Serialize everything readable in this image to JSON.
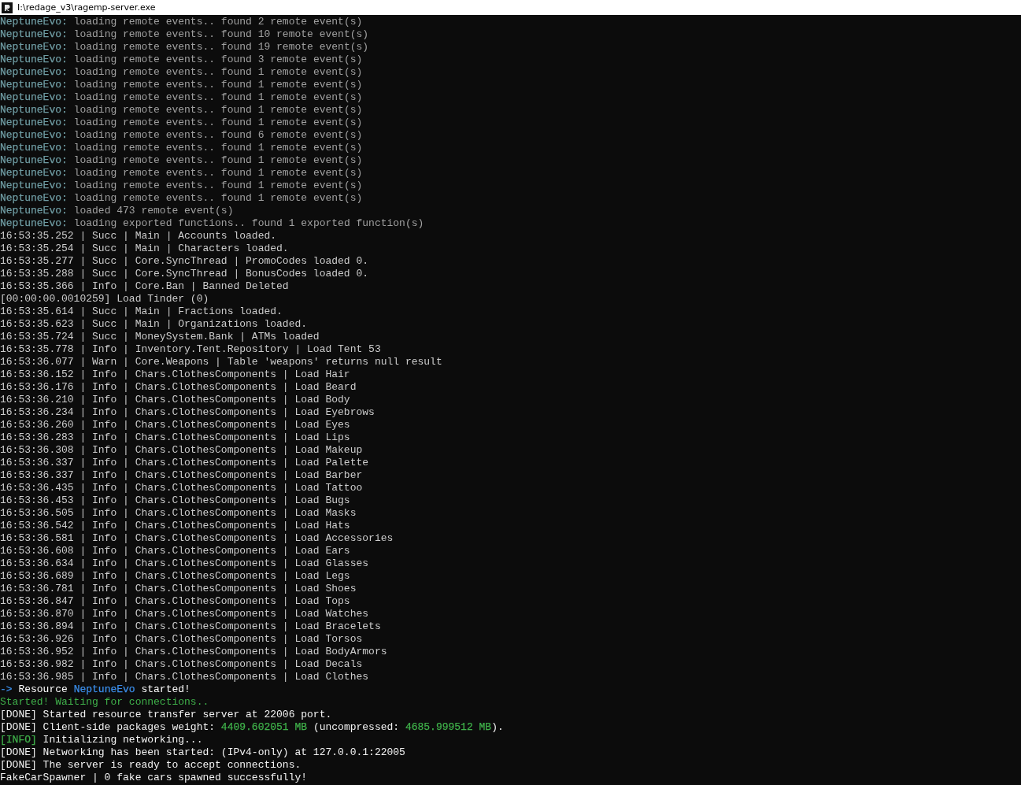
{
  "window": {
    "title": "I:\\redage_v3\\ragemp-server.exe"
  },
  "lines": [
    {
      "color": "#a0a0a0",
      "segments": [
        {
          "text": "NeptuneEvo:",
          "color": "#6f9ca3"
        },
        {
          "text": " loading remote events.. found 2 remote event(s)"
        }
      ]
    },
    {
      "color": "#a0a0a0",
      "segments": [
        {
          "text": "NeptuneEvo:",
          "color": "#6f9ca3"
        },
        {
          "text": " loading remote events.. found 10 remote event(s)"
        }
      ]
    },
    {
      "color": "#a0a0a0",
      "segments": [
        {
          "text": "NeptuneEvo:",
          "color": "#6f9ca3"
        },
        {
          "text": " loading remote events.. found 19 remote event(s)"
        }
      ]
    },
    {
      "color": "#a0a0a0",
      "segments": [
        {
          "text": "NeptuneEvo:",
          "color": "#6f9ca3"
        },
        {
          "text": " loading remote events.. found 3 remote event(s)"
        }
      ]
    },
    {
      "color": "#a0a0a0",
      "segments": [
        {
          "text": "NeptuneEvo:",
          "color": "#6f9ca3"
        },
        {
          "text": " loading remote events.. found 1 remote event(s)"
        }
      ]
    },
    {
      "color": "#a0a0a0",
      "segments": [
        {
          "text": "NeptuneEvo:",
          "color": "#6f9ca3"
        },
        {
          "text": " loading remote events.. found 1 remote event(s)"
        }
      ]
    },
    {
      "color": "#a0a0a0",
      "segments": [
        {
          "text": "NeptuneEvo:",
          "color": "#6f9ca3"
        },
        {
          "text": " loading remote events.. found 1 remote event(s)"
        }
      ]
    },
    {
      "color": "#a0a0a0",
      "segments": [
        {
          "text": "NeptuneEvo:",
          "color": "#6f9ca3"
        },
        {
          "text": " loading remote events.. found 1 remote event(s)"
        }
      ]
    },
    {
      "color": "#a0a0a0",
      "segments": [
        {
          "text": "NeptuneEvo:",
          "color": "#6f9ca3"
        },
        {
          "text": " loading remote events.. found 1 remote event(s)"
        }
      ]
    },
    {
      "color": "#a0a0a0",
      "segments": [
        {
          "text": "NeptuneEvo:",
          "color": "#6f9ca3"
        },
        {
          "text": " loading remote events.. found 6 remote event(s)"
        }
      ]
    },
    {
      "color": "#a0a0a0",
      "segments": [
        {
          "text": "NeptuneEvo:",
          "color": "#6f9ca3"
        },
        {
          "text": " loading remote events.. found 1 remote event(s)"
        }
      ]
    },
    {
      "color": "#a0a0a0",
      "segments": [
        {
          "text": "NeptuneEvo:",
          "color": "#6f9ca3"
        },
        {
          "text": " loading remote events.. found 1 remote event(s)"
        }
      ]
    },
    {
      "color": "#a0a0a0",
      "segments": [
        {
          "text": "NeptuneEvo:",
          "color": "#6f9ca3"
        },
        {
          "text": " loading remote events.. found 1 remote event(s)"
        }
      ]
    },
    {
      "color": "#a0a0a0",
      "segments": [
        {
          "text": "NeptuneEvo:",
          "color": "#6f9ca3"
        },
        {
          "text": " loading remote events.. found 1 remote event(s)"
        }
      ]
    },
    {
      "color": "#a0a0a0",
      "segments": [
        {
          "text": "NeptuneEvo:",
          "color": "#6f9ca3"
        },
        {
          "text": " loading remote events.. found 1 remote event(s)"
        }
      ]
    },
    {
      "color": "#a0a0a0",
      "segments": [
        {
          "text": "NeptuneEvo:",
          "color": "#6f9ca3"
        },
        {
          "text": " loaded 473 remote event(s)"
        }
      ]
    },
    {
      "color": "#a0a0a0",
      "segments": [
        {
          "text": "NeptuneEvo:",
          "color": "#6f9ca3"
        },
        {
          "text": " loading exported functions.. found 1 exported function(s)"
        }
      ]
    },
    {
      "color": "#cccccc",
      "segments": [
        {
          "text": "16:53:35.252 | Succ | Main | Accounts loaded."
        }
      ]
    },
    {
      "color": "#cccccc",
      "segments": [
        {
          "text": "16:53:35.254 | Succ | Main | Characters loaded."
        }
      ]
    },
    {
      "color": "#cccccc",
      "segments": [
        {
          "text": "16:53:35.277 | Succ | Core.SyncThread | PromoCodes loaded 0."
        }
      ]
    },
    {
      "color": "#cccccc",
      "segments": [
        {
          "text": "16:53:35.288 | Succ | Core.SyncThread | BonusCodes loaded 0."
        }
      ]
    },
    {
      "color": "#cccccc",
      "segments": [
        {
          "text": "16:53:35.366 | Info | Core.Ban | Banned Deleted"
        }
      ]
    },
    {
      "color": "#cccccc",
      "segments": [
        {
          "text": "[00:00:00.0010259] Load Tinder (0)"
        }
      ]
    },
    {
      "color": "#cccccc",
      "segments": [
        {
          "text": "16:53:35.614 | Succ | Main | Fractions loaded."
        }
      ]
    },
    {
      "color": "#cccccc",
      "segments": [
        {
          "text": "16:53:35.623 | Succ | Main | Organizations loaded."
        }
      ]
    },
    {
      "color": "#cccccc",
      "segments": [
        {
          "text": "16:53:35.724 | Succ | MoneySystem.Bank | ATMs loaded"
        }
      ]
    },
    {
      "color": "#cccccc",
      "segments": [
        {
          "text": "16:53:35.778 | Info | Inventory.Tent.Repository | Load Tent 53"
        }
      ]
    },
    {
      "color": "#cccccc",
      "segments": [
        {
          "text": "16:53:36.077 | Warn | Core.Weapons | Table 'weapons' returns null result"
        }
      ]
    },
    {
      "color": "#cccccc",
      "segments": [
        {
          "text": "16:53:36.152 | Info | Chars.ClothesComponents | Load Hair"
        }
      ]
    },
    {
      "color": "#cccccc",
      "segments": [
        {
          "text": "16:53:36.176 | Info | Chars.ClothesComponents | Load Beard"
        }
      ]
    },
    {
      "color": "#cccccc",
      "segments": [
        {
          "text": "16:53:36.210 | Info | Chars.ClothesComponents | Load Body"
        }
      ]
    },
    {
      "color": "#cccccc",
      "segments": [
        {
          "text": "16:53:36.234 | Info | Chars.ClothesComponents | Load Eyebrows"
        }
      ]
    },
    {
      "color": "#cccccc",
      "segments": [
        {
          "text": "16:53:36.260 | Info | Chars.ClothesComponents | Load Eyes"
        }
      ]
    },
    {
      "color": "#cccccc",
      "segments": [
        {
          "text": "16:53:36.283 | Info | Chars.ClothesComponents | Load Lips"
        }
      ]
    },
    {
      "color": "#cccccc",
      "segments": [
        {
          "text": "16:53:36.308 | Info | Chars.ClothesComponents | Load Makeup"
        }
      ]
    },
    {
      "color": "#cccccc",
      "segments": [
        {
          "text": "16:53:36.337 | Info | Chars.ClothesComponents | Load Palette"
        }
      ]
    },
    {
      "color": "#cccccc",
      "segments": [
        {
          "text": "16:53:36.337 | Info | Chars.ClothesComponents | Load Barber"
        }
      ]
    },
    {
      "color": "#cccccc",
      "segments": [
        {
          "text": "16:53:36.435 | Info | Chars.ClothesComponents | Load Tattoo"
        }
      ]
    },
    {
      "color": "#cccccc",
      "segments": [
        {
          "text": "16:53:36.453 | Info | Chars.ClothesComponents | Load Bugs"
        }
      ]
    },
    {
      "color": "#cccccc",
      "segments": [
        {
          "text": "16:53:36.505 | Info | Chars.ClothesComponents | Load Masks"
        }
      ]
    },
    {
      "color": "#cccccc",
      "segments": [
        {
          "text": "16:53:36.542 | Info | Chars.ClothesComponents | Load Hats"
        }
      ]
    },
    {
      "color": "#cccccc",
      "segments": [
        {
          "text": "16:53:36.581 | Info | Chars.ClothesComponents | Load Accessories"
        }
      ]
    },
    {
      "color": "#cccccc",
      "segments": [
        {
          "text": "16:53:36.608 | Info | Chars.ClothesComponents | Load Ears"
        }
      ]
    },
    {
      "color": "#cccccc",
      "segments": [
        {
          "text": "16:53:36.634 | Info | Chars.ClothesComponents | Load Glasses"
        }
      ]
    },
    {
      "color": "#cccccc",
      "segments": [
        {
          "text": "16:53:36.689 | Info | Chars.ClothesComponents | Load Legs"
        }
      ]
    },
    {
      "color": "#cccccc",
      "segments": [
        {
          "text": "16:53:36.781 | Info | Chars.ClothesComponents | Load Shoes"
        }
      ]
    },
    {
      "color": "#cccccc",
      "segments": [
        {
          "text": "16:53:36.847 | Info | Chars.ClothesComponents | Load Tops"
        }
      ]
    },
    {
      "color": "#cccccc",
      "segments": [
        {
          "text": "16:53:36.870 | Info | Chars.ClothesComponents | Load Watches"
        }
      ]
    },
    {
      "color": "#cccccc",
      "segments": [
        {
          "text": "16:53:36.894 | Info | Chars.ClothesComponents | Load Bracelets"
        }
      ]
    },
    {
      "color": "#cccccc",
      "segments": [
        {
          "text": "16:53:36.926 | Info | Chars.ClothesComponents | Load Torsos"
        }
      ]
    },
    {
      "color": "#cccccc",
      "segments": [
        {
          "text": "16:53:36.952 | Info | Chars.ClothesComponents | Load BodyArmors"
        }
      ]
    },
    {
      "color": "#cccccc",
      "segments": [
        {
          "text": "16:53:36.982 | Info | Chars.ClothesComponents | Load Decals"
        }
      ]
    },
    {
      "color": "#cccccc",
      "segments": [
        {
          "text": "16:53:36.985 | Info | Chars.ClothesComponents | Load Clothes"
        }
      ]
    },
    {
      "color": "#ffffff",
      "segments": [
        {
          "text": "->",
          "color": "#3b8eea"
        },
        {
          "text": " Resource "
        },
        {
          "text": "NeptuneEvo",
          "color": "#3b8eea"
        },
        {
          "text": " started!"
        }
      ]
    },
    {
      "color": "#3fb04a",
      "segments": [
        {
          "text": "Started! Waiting for connections.."
        }
      ]
    },
    {
      "color": "#f2f2f2",
      "segments": [
        {
          "text": "[DONE] Started resource transfer server at 22006 port."
        }
      ]
    },
    {
      "color": "#f2f2f2",
      "segments": [
        {
          "text": "[DONE] Client-side packages weight: "
        },
        {
          "text": "4409.602051 MB",
          "color": "#3fb04a"
        },
        {
          "text": " (uncompressed: "
        },
        {
          "text": "4685.999512 MB",
          "color": "#3fb04a"
        },
        {
          "text": ")."
        }
      ]
    },
    {
      "color": "#f2f2f2",
      "segments": [
        {
          "text": "[INFO]",
          "color": "#3fb04a"
        },
        {
          "text": " Initializing networking..."
        }
      ]
    },
    {
      "color": "#f2f2f2",
      "segments": [
        {
          "text": "[DONE] Networking has been started: (IPv4-only) at 127.0.0.1:22005"
        }
      ]
    },
    {
      "color": "#f2f2f2",
      "segments": [
        {
          "text": "[DONE] The server is ready to accept connections."
        }
      ]
    },
    {
      "color": "#f2f2f2",
      "segments": [
        {
          "text": "FakeCarSpawner | 0 fake cars spawned successfully!"
        }
      ]
    }
  ]
}
